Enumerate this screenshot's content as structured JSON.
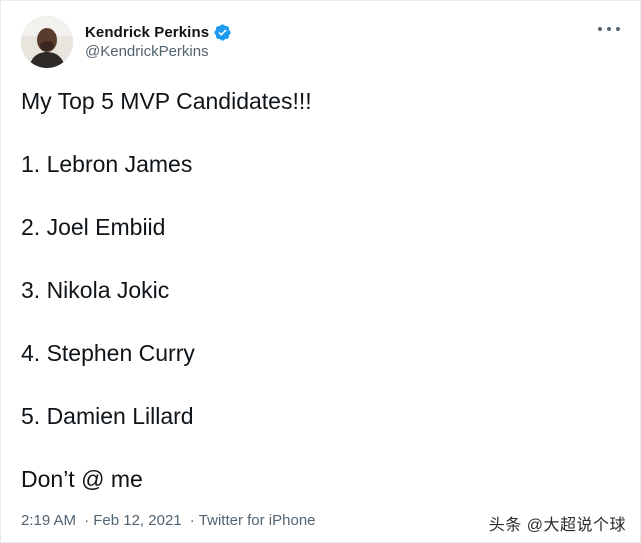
{
  "author": {
    "name": "Kendrick Perkins",
    "handle": "@KendrickPerkins",
    "verified": true,
    "avatar_icon": "profile-photo"
  },
  "more_menu_icon": "ellipsis-icon",
  "tweet": {
    "lines": [
      "My Top 5 MVP Candidates!!!",
      "1. Lebron James",
      "2. Joel Embiid",
      "3. Nikola Jokic",
      "4. Stephen Curry",
      "5. Damien Lillard",
      "Don’t @ me"
    ]
  },
  "meta": {
    "time": "2:19 AM",
    "separator": "·",
    "date": "Feb 12, 2021",
    "source": "Twitter for iPhone"
  },
  "watermark": "头条 @大超说个球",
  "colors": {
    "verified_blue": "#1d9bf0",
    "secondary_text": "#536471",
    "primary_text": "#0f1419"
  }
}
